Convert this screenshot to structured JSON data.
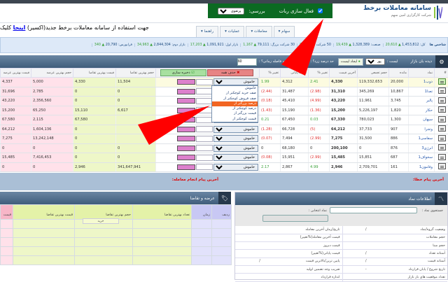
{
  "header": {
    "logo_title": "سامانه معاملات برخط",
    "logo_subtitle": "شرکت کارگزاری امین سهم",
    "robot_label": "فعال سازی ربات",
    "robot_checked": true,
    "review_label": "بررسی:",
    "review_value": "پرتفوی",
    "bg_color": "#0b6a22"
  },
  "notice": {
    "text": "جهت استفاده از سامانه معاملات برخط جدید(اکسیر) ",
    "link": "اینجا",
    "tail": " کلیک"
  },
  "menu": [
    {
      "label": "سهام"
    },
    {
      "label": "معاملات"
    },
    {
      "label": "عملیات"
    },
    {
      "label": "راهنما"
    }
  ],
  "indices": {
    "title": "شاخص ها",
    "items": [
      {
        "name": "کل:",
        "value": "1,453,812",
        "change": "20,610"
      },
      {
        "name": "صنعت:",
        "value": "1,328,389",
        "change": "19,439"
      },
      {
        "name": "50 شرکت",
        "value": "57",
        "change": "896"
      },
      {
        "name": "30 شرکت بزرگ:",
        "value": "79,111",
        "change": "1,167"
      },
      {
        "name": "بازار اول:",
        "value": "1,091,921",
        "change": "17,203"
      },
      {
        "name": "بازار دوم:",
        "value": "2,844,304",
        "change": "34,963"
      },
      {
        "name": "فرابورس:",
        "value": "20,790",
        "change": "340"
      }
    ]
  },
  "market_watch": {
    "title": "دیده بان بازار",
    "list_label": "لیست :",
    "list_value": "پورتفو 1",
    "create_list": "ایجاد لیست",
    "threshold_label": "حد درصد زرد؟ :",
    "threshold_value": "1",
    "interval_label": "چه فاصله زمانی؟ :",
    "interval_value": "60",
    "delete_all": "حذف همه",
    "save": "ذخیره سازی",
    "columns": [
      "#",
      "نماد",
      "مانده",
      "حجم تجمعی",
      "آخرین قیمت",
      "تغییر %",
      "قیمت پایانی",
      "تغییر %",
      "",
      "حجم بهترین تقاضا",
      "قیمت بهترین تقاضا",
      "حجم بهترین عرضه",
      "قیمت بهترین عرضه"
    ],
    "alert_value": "خاموش",
    "rows": [
      {
        "symbol": "ذوب1",
        "remain": "20,000",
        "volume": "119,332,653",
        "last": "4,330",
        "last_pct": "2.41",
        "close": "4,312",
        "close_pct": "1.99",
        "bid_vol": "11,504",
        "bid_price": "4,330",
        "ask_vol": "5,000",
        "ask_price": "4,337"
      },
      {
        "symbol": "تعدا1",
        "remain": "10,867",
        "volume": "345,269",
        "last": "31,310",
        "last_pct": "(2.98)",
        "close": "31,487",
        "close_pct": "(2.44)",
        "bid_vol": "0",
        "bid_price": "0",
        "ask_vol": "2,785",
        "ask_price": "31,696"
      },
      {
        "symbol": "پالبر",
        "remain": "3,745",
        "volume": "11,961",
        "last": "43,220",
        "last_pct": "(4.99)",
        "close": "45,410",
        "close_pct": "(0.18)",
        "bid_vol": "0",
        "bid_price": "0",
        "ask_vol": "2,356,560",
        "ask_price": "43,220"
      },
      {
        "symbol": "حکار",
        "remain": "1,820",
        "volume": "5,226,197",
        "last": "15,200",
        "last_pct": "(1.36)",
        "close": "15,190",
        "close_pct": "(1.43)",
        "bid_vol": "6,617",
        "bid_price": "15,110",
        "ask_vol": "65,250",
        "ask_price": "15,200"
      },
      {
        "symbol": "سپهان",
        "remain": "1,300",
        "volume": "780,023",
        "last": "67,330",
        "last_pct": "0.03",
        "close": "67,450",
        "close_pct": "0.21",
        "bid_vol": "",
        "bid_price": "67,580",
        "ask_vol": "2,115",
        "ask_price": "67,580"
      },
      {
        "symbol": "وتجرا",
        "remain": "907",
        "volume": "37,733",
        "last": "64,212",
        "last_pct": "(5)",
        "close": "66,728",
        "close_pct": "(1.28)",
        "bid_vol": "",
        "bid_price": "0",
        "ask_vol": "1,604,136",
        "ask_price": "64,212"
      },
      {
        "symbol": "سفاسی1",
        "remain": "886",
        "volume": "31,500",
        "last": "7,275",
        "last_pct": "(2.99)",
        "close": "7,494",
        "close_pct": "(0.07)",
        "bid_vol": "",
        "bid_price": "0",
        "ask_vol": "13,242,148",
        "ask_price": "7,275"
      },
      {
        "symbol": "انرژی3",
        "remain": "876",
        "volume": "0",
        "last": "200,100",
        "last_pct": "0",
        "close": "68,180",
        "close_pct": "0",
        "bid_vol": "0",
        "bid_price": "0",
        "ask_vol": "0",
        "ask_price": "0"
      },
      {
        "symbol": "سخواف1",
        "remain": "687",
        "volume": "15,851",
        "last": "15,485",
        "last_pct": "(2.99)",
        "close": "15,951",
        "close_pct": "(0.08)",
        "bid_vol": "0",
        "bid_price": "0",
        "ask_vol": "7,416,453",
        "ask_price": "15,485"
      },
      {
        "symbol": "وفامون1",
        "remain": "161",
        "volume": "2,709,701",
        "last": "2,946",
        "last_pct": "4.99",
        "close": "2,867",
        "close_pct": "2.17",
        "bid_vol": "341,647,941",
        "bid_price": "2,946",
        "ask_vol": "0",
        "ask_price": "0"
      }
    ],
    "dropdown_options": [
      "خاموش",
      "صف خرید کوچکتر از",
      "صف فروش کوچکتر از",
      "درصد بزرگتر از",
      "درصد کوچکتر از",
      "قیمت بزرگتر از",
      "قیمت کوچکتر از"
    ],
    "dropdown_selected": "درصد بزرگتر از"
  },
  "messages": {
    "last_error": "آخرین پیام خطا:",
    "last_trade": "آخرین پیام انجام معامله:"
  },
  "order_book": {
    "title": "عرضه و تقاضا",
    "buy_label": "خرید",
    "columns": [
      "ردیف",
      "زمان",
      "تعداد بهترین تقاضا",
      "حجم بهترین تقاضا",
      "قیمت بهترین تقاضا",
      "قیمت"
    ]
  },
  "symbol_info": {
    "title": "اطلاعات نماد",
    "search_label": "جستجوی نماد :",
    "selected_label": "نماد انتخابی :",
    "rows": [
      {
        "l1": "وضعیت گروه/نماد",
        "v1": "/",
        "l2": "تاریخ/زمان آخرین معامله",
        "v2": ""
      },
      {
        "l1": "حجم معاملات",
        "v1": "",
        "l2": "قیمت آخرین معامله(%تغییر)",
        "v2": ""
      },
      {
        "l1": "حجم مبنا",
        "v1": "",
        "l2": "قیمت دیروز",
        "v2": ""
      },
      {
        "l1": "آستانه تعداد",
        "v1": "/",
        "l2": "قیمت پایانی(%تغییر)",
        "v2": ""
      },
      {
        "l1": "آستانه قیمت",
        "v1": "/",
        "l2": "پایین ترین/بالاترین قیمت",
        "v2": "/"
      },
      {
        "l1": "تاریخ شروع / پایان قرارداد",
        "v1": "-",
        "l2": "ضریب وجه تضمین اولیه",
        "v2": ""
      },
      {
        "l1": "تعداد موقعیت های باز بازار",
        "v1": "",
        "l2": "اندازه قرارداد",
        "v2": ""
      }
    ]
  },
  "colors": {
    "bid": "#eef7c8",
    "ask": "#ffe1ea",
    "negative": "#e03030",
    "positive": "#3aa13a",
    "annotation_arrow": "#ff0000"
  }
}
